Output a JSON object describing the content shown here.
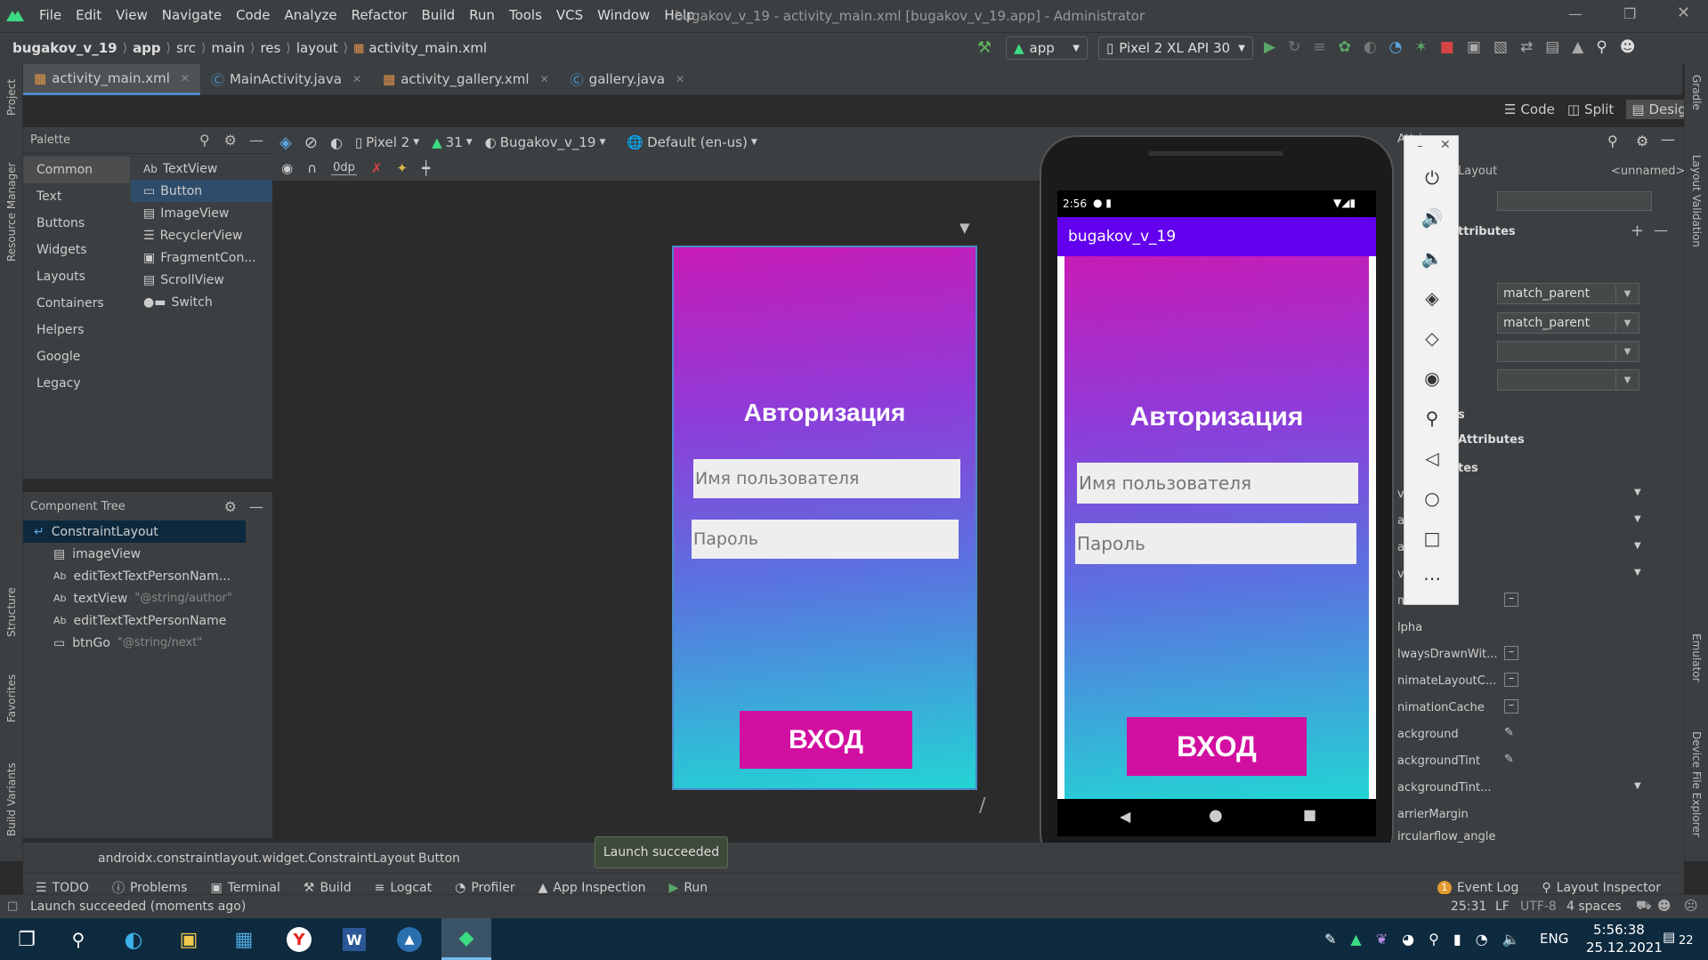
{
  "window": {
    "title": "bugakov_v_19 - activity_main.xml [bugakov_v_19.app] - Administrator",
    "menu": [
      "File",
      "Edit",
      "View",
      "Navigate",
      "Code",
      "Analyze",
      "Refactor",
      "Build",
      "Run",
      "Tools",
      "VCS",
      "Window",
      "Help"
    ]
  },
  "breadcrumb": [
    "bugakov_v_19",
    "app",
    "src",
    "main",
    "res",
    "layout",
    "activity_main.xml"
  ],
  "run_config": {
    "module": "app",
    "device": "Pixel 2 XL API 30"
  },
  "tabs": [
    {
      "label": "activity_main.xml"
    },
    {
      "label": "MainActivity.java"
    },
    {
      "label": "activity_gallery.xml"
    },
    {
      "label": "gallery.java"
    }
  ],
  "view_modes": {
    "code": "Code",
    "split": "Split",
    "design": "Design"
  },
  "left_strip": [
    "Project",
    "Resource Manager",
    "Structure",
    "Favorites",
    "Build Variants"
  ],
  "right_strip": [
    "Gradle",
    "Layout Validation",
    "Emulator",
    "Device File Explorer"
  ],
  "palette": {
    "title": "Palette",
    "categories": [
      "Common",
      "Text",
      "Buttons",
      "Widgets",
      "Layouts",
      "Containers",
      "Helpers",
      "Google",
      "Legacy"
    ],
    "items": [
      {
        "icon": "Ab",
        "label": "TextView"
      },
      {
        "icon": "btn",
        "label": "Button"
      },
      {
        "icon": "img",
        "label": "ImageView"
      },
      {
        "icon": "list",
        "label": "RecyclerView"
      },
      {
        "icon": "frag",
        "label": "FragmentCon..."
      },
      {
        "icon": "scroll",
        "label": "ScrollView"
      },
      {
        "icon": "switch",
        "label": "Switch"
      }
    ]
  },
  "component_tree": {
    "title": "Component Tree",
    "root": "ConstraintLayout",
    "children": [
      {
        "icon": "img",
        "label": "imageView",
        "hint": ""
      },
      {
        "icon": "Ab",
        "label": "editTextTextPersonNam...",
        "hint": ""
      },
      {
        "icon": "Ab",
        "label": "textView",
        "hint": "\"@string/author\""
      },
      {
        "icon": "Ab",
        "label": "editTextTextPersonName",
        "hint": ""
      },
      {
        "icon": "btn",
        "label": "btnGo",
        "hint": "\"@string/next\""
      }
    ]
  },
  "design_toolbar": {
    "device": "Pixel 2",
    "api": "31",
    "theme": "Bugakov_v_19",
    "locale": "Default (en-us)",
    "margin": "0dp"
  },
  "layout_preview": {
    "heading": "Авторизация",
    "username_hint": "Имя пользователя",
    "password_hint": "Пароль",
    "button": "ВХОД"
  },
  "emulator": {
    "time": "2:56",
    "app_title": "bugakov_v_19",
    "heading": "Авторизация",
    "username_hint": "Имя пользователя",
    "password_hint": "Пароль",
    "button": "ВХОД"
  },
  "attributes": {
    "panel_title": "Attri",
    "layout_label": "Layout",
    "id_value": "<unnamed>",
    "sections": [
      "ttributes",
      "s",
      "Attributes",
      "tes"
    ],
    "layout_width": "match_parent",
    "layout_height": "match_parent",
    "rows": [
      "veR...",
      "ave...",
      "ave...",
      "vMo...",
      "mC...",
      "lpha",
      "lwaysDrawnWit...",
      "nimateLayoutC...",
      "nimationCache",
      "ackground",
      "ackgroundTint",
      "ackgroundTint...",
      "arrierMargin",
      "ircularflow_angle"
    ]
  },
  "status_path": {
    "class": "androidx.constraintlayout.widget.ConstraintLayout",
    "item": "Button"
  },
  "toast": "Launch succeeded",
  "bottom_tools": [
    "TODO",
    "Problems",
    "Terminal",
    "Build",
    "Logcat",
    "Profiler",
    "App Inspection",
    "Run"
  ],
  "bottom_right_tools": [
    "Event Log",
    "Layout Inspector"
  ],
  "event_log_count": "1",
  "status": {
    "message": "Launch succeeded (moments ago)",
    "position": "25:31",
    "line_sep": "LF",
    "encoding": "UTF-8",
    "indent": "4 spaces"
  },
  "taskbar": {
    "language": "ENG",
    "time": "5:56:38",
    "date": "25.12.2021",
    "notifications": "22"
  },
  "colors": {
    "accent": "#4a88c7",
    "app_bar": "#6200ee",
    "button": "#d10fa0"
  }
}
